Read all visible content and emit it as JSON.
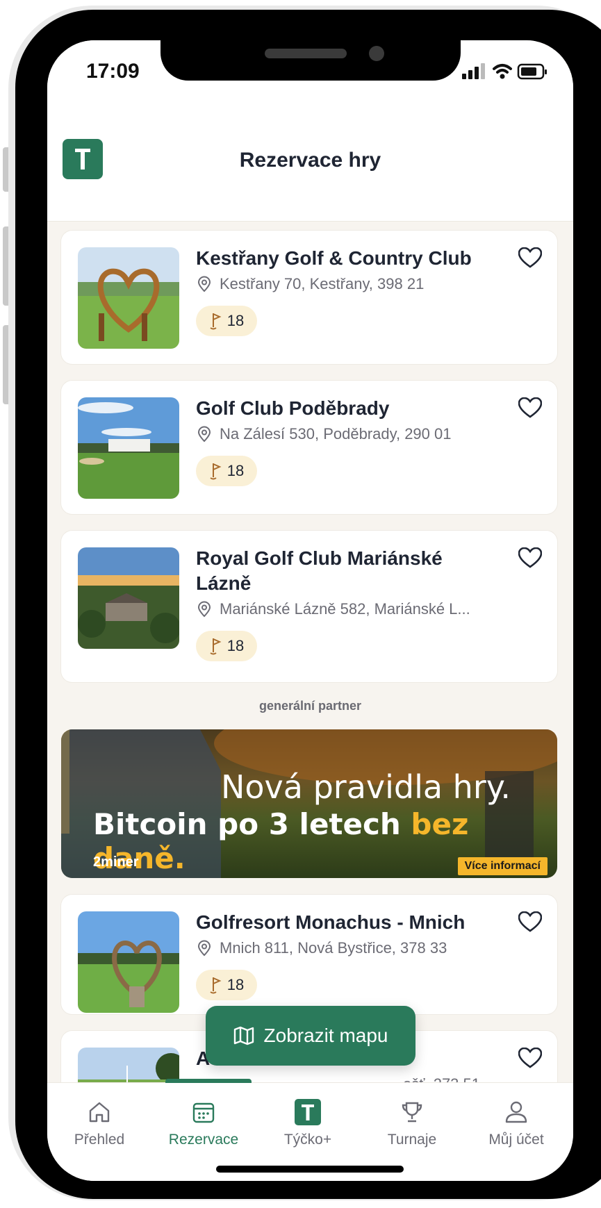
{
  "status": {
    "time": "17:09"
  },
  "header": {
    "title": "Rezervace hry"
  },
  "courses": [
    {
      "name": "Kestřany Golf & Country Club",
      "address": "Kestřany 70, Kestřany, 398 21",
      "holes": "18"
    },
    {
      "name": "Golf Club Poděbrady",
      "address": "Na Zálesí 530, Poděbrady, 290 01",
      "holes": "18"
    },
    {
      "name": "Royal Golf Club Mariánské Lázně",
      "address": "Mariánské Lázně 582, Mariánské L...",
      "holes": "18"
    },
    {
      "name": "Golfresort Monachus - Mnich",
      "address": "Mnich 811, Nová Bystřice, 378 33",
      "holes": "18"
    },
    {
      "name": "A",
      "address": "…ošť, 273 51",
      "holes": ""
    }
  ],
  "partner": {
    "label": "generální partner",
    "banner_line1": "Nová pravidla hry.",
    "banner_line2_a": "Bitcoin po 3 letech ",
    "banner_line2_b": "bez daně.",
    "brand": "2miner",
    "cta": "Více informací"
  },
  "map_button": {
    "label": "Zobrazit mapu"
  },
  "tabs": [
    {
      "label": "Přehled",
      "icon": "home-icon"
    },
    {
      "label": "Rezervace",
      "icon": "calendar-icon"
    },
    {
      "label": "Týčko+",
      "icon": "tee-logo-icon"
    },
    {
      "label": "Turnaje",
      "icon": "trophy-icon"
    },
    {
      "label": "Můj účet",
      "icon": "user-icon"
    }
  ],
  "colors": {
    "brand_green": "#2a7a5b",
    "badge_bg": "#faf0d6",
    "accent_yellow": "#f5b62b"
  }
}
